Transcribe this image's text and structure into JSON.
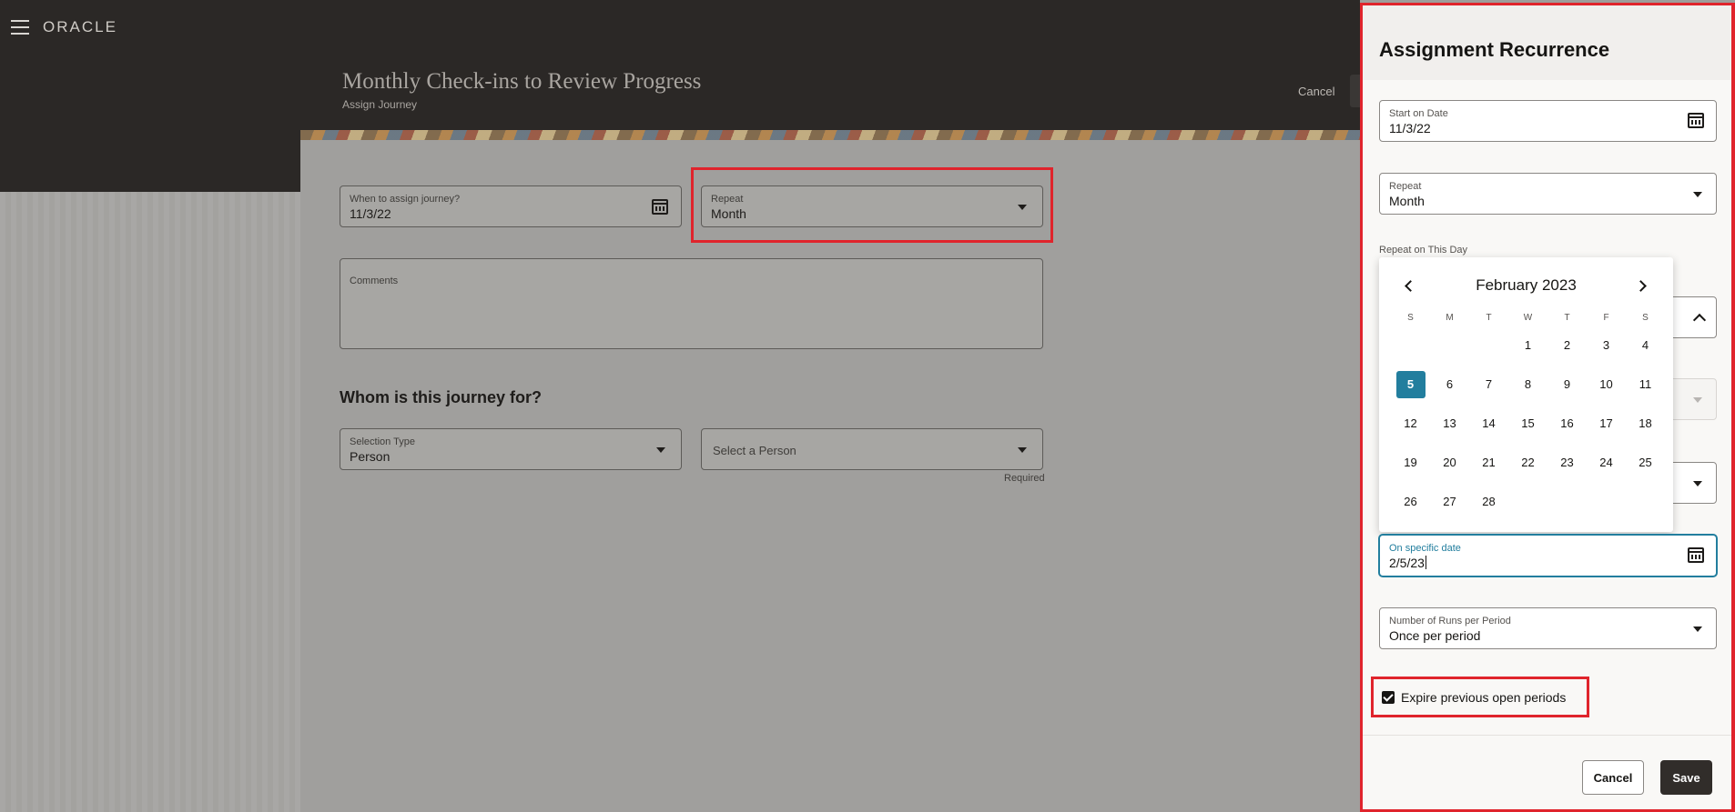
{
  "app": {
    "logo": "ORACLE"
  },
  "page": {
    "title": "Monthly Check-ins to Review Progress",
    "subtitle": "Assign Journey",
    "cancel_label": "Cancel"
  },
  "form": {
    "when": {
      "label": "When to assign journey?",
      "value": "11/3/22",
      "icon": "calendar-icon"
    },
    "repeat": {
      "label": "Repeat",
      "value": "Month"
    },
    "comments": {
      "label": "Comments",
      "value": ""
    },
    "section_heading": "Whom is this journey for?",
    "selection_type": {
      "label": "Selection Type",
      "value": "Person"
    },
    "select_person": {
      "placeholder": "Select a Person",
      "helper": "Required"
    }
  },
  "drawer": {
    "title": "Assignment Recurrence",
    "start_on_date": {
      "label": "Start on Date",
      "value": "11/3/22",
      "icon": "calendar-icon"
    },
    "repeat": {
      "label": "Repeat",
      "value": "Month"
    },
    "repeat_on_this_day": {
      "label": "Repeat on This Day"
    },
    "calendar": {
      "month_label": "February 2023",
      "weekdays": [
        "S",
        "M",
        "T",
        "W",
        "T",
        "F",
        "S"
      ],
      "weeks": [
        [
          "",
          "",
          "",
          "1",
          "2",
          "3",
          "4"
        ],
        [
          "5",
          "6",
          "7",
          "8",
          "9",
          "10",
          "11"
        ],
        [
          "12",
          "13",
          "14",
          "15",
          "16",
          "17",
          "18"
        ],
        [
          "19",
          "20",
          "21",
          "22",
          "23",
          "24",
          "25"
        ],
        [
          "26",
          "27",
          "28",
          "",
          "",
          "",
          ""
        ]
      ],
      "selected_day": "5"
    },
    "on_specific_date": {
      "label": "On specific date",
      "value": "2/5/23"
    },
    "runs_per_period": {
      "label": "Number of Runs per Period",
      "value": "Once per period"
    },
    "expire_checkbox": {
      "label": "Expire previous open periods",
      "checked": true
    },
    "cancel_label": "Cancel",
    "save_label": "Save"
  },
  "colors": {
    "accent": "#227e9e",
    "highlight": "#e0242c",
    "header_dark": "#2b2826",
    "primary_button": "#312d2a"
  }
}
